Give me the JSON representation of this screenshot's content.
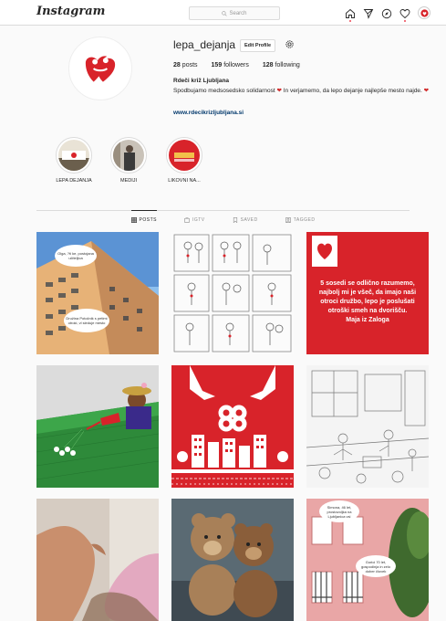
{
  "topbar": {
    "logo": "Instagram",
    "search_placeholder": "Search"
  },
  "profile": {
    "username": "lepa_dejanja",
    "edit_label": "Edit Profile",
    "posts_count": "28",
    "posts_label": "posts",
    "followers_count": "159",
    "followers_label": "followers",
    "following_count": "128",
    "following_label": "following",
    "full_name": "Rdeči križ Ljubljana",
    "bio_1": "Spodbujamo medsosedsko solidarnost",
    "bio_2": "In verjamemo, da lepo dejanje najlepše mesto najde.",
    "link": "www.rdecikrizljubljana.si"
  },
  "highlights": [
    {
      "label": "LEPA DEJANJA"
    },
    {
      "label": "MEDIJI"
    },
    {
      "label": "LIKOVNI NA..."
    }
  ],
  "tabs": [
    {
      "label": "POSTS",
      "active": true
    },
    {
      "label": "IGTV"
    },
    {
      "label": "SAVED"
    },
    {
      "label": "TAGGED"
    }
  ],
  "posts": {
    "p1_bubble1": "Olga, ?ti ke, postojana učiteljica",
    "p1_bubble2": "Družina Potočnik s petimi otroki, vl sleduje mesto",
    "p3_quote_1": "5 sosedi se odlično razumemo, najbolj mi je všeč, da imajo naši otroci družbo, lepo je poslušati otroški smeh na dvorišču.",
    "p3_quote_2": "Maja iz Zaloga",
    "p9_bubble1": "Simona, 46 let, prostovoljka na Ljubljanica vsi",
    "p9_bubble2": "Gorici 70 let, gospodinja in zelo dober človek"
  },
  "colors": {
    "accent": "#d8232a",
    "link": "#00376b",
    "notification": "#ed4956"
  }
}
